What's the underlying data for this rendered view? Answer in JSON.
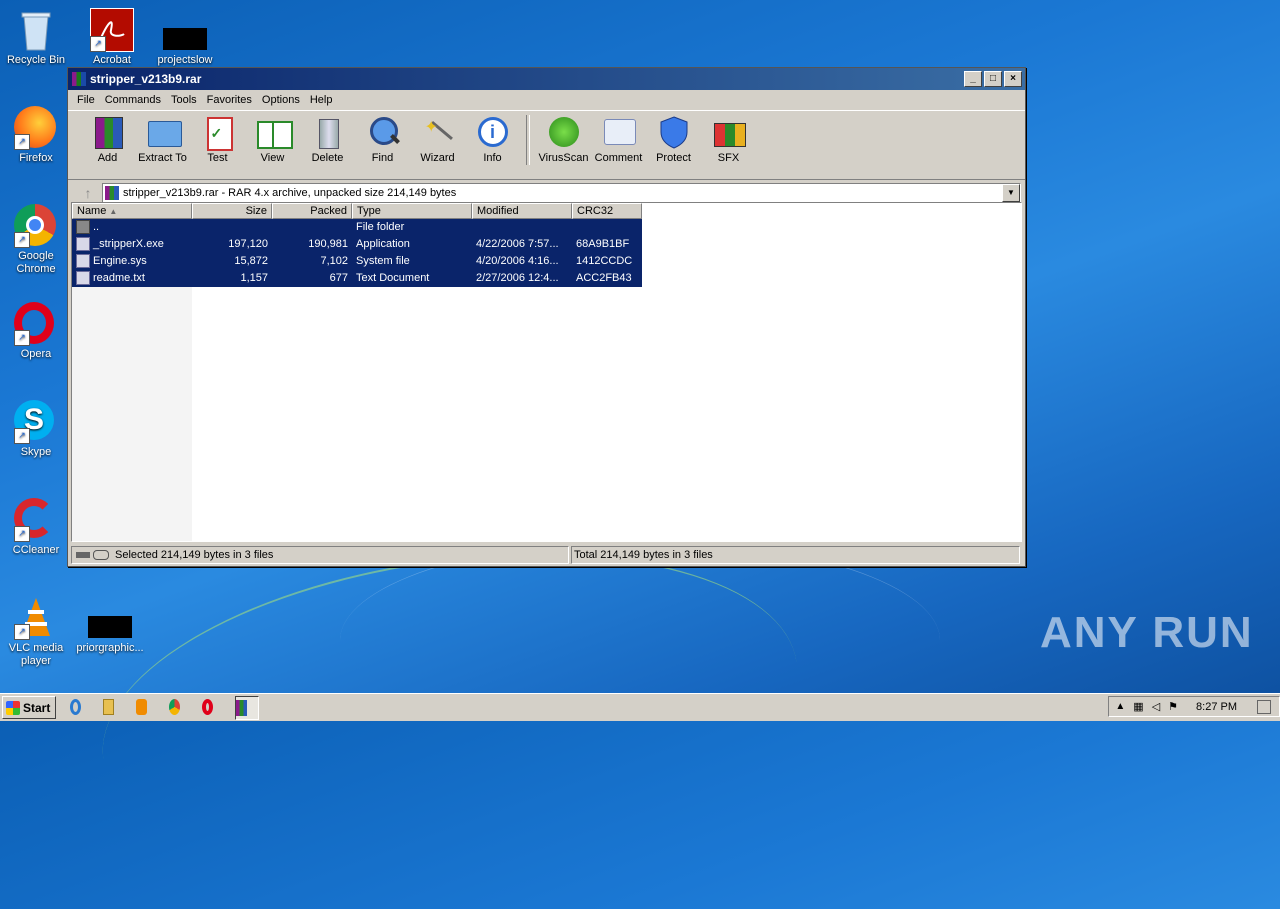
{
  "desktop": {
    "icons": [
      {
        "label": "Recycle Bin"
      },
      {
        "label": "Acrobat"
      },
      {
        "label": "projectslow"
      },
      {
        "label": "Firefox"
      },
      {
        "label": "Google Chrome"
      },
      {
        "label": "Opera"
      },
      {
        "label": "Skype"
      },
      {
        "label": "CCleaner"
      },
      {
        "label": "VLC media player"
      },
      {
        "label": "priorgraphic..."
      }
    ],
    "watermark": "ANY RUN"
  },
  "window": {
    "title": "stripper_v213b9.rar",
    "menu": [
      "File",
      "Commands",
      "Tools",
      "Favorites",
      "Options",
      "Help"
    ],
    "toolbar": [
      "Add",
      "Extract To",
      "Test",
      "View",
      "Delete",
      "Find",
      "Wizard",
      "Info",
      "VirusScan",
      "Comment",
      "Protect",
      "SFX"
    ],
    "path": "stripper_v213b9.rar - RAR 4.x archive, unpacked size 214,149 bytes",
    "columns": [
      "Name",
      "Size",
      "Packed",
      "Type",
      "Modified",
      "CRC32"
    ],
    "files": [
      {
        "name": "..",
        "size": "",
        "packed": "",
        "type": "File folder",
        "modified": "",
        "crc": ""
      },
      {
        "name": "_stripperX.exe",
        "size": "197,120",
        "packed": "190,981",
        "type": "Application",
        "modified": "4/22/2006 7:57...",
        "crc": "68A9B1BF"
      },
      {
        "name": "Engine.sys",
        "size": "15,872",
        "packed": "7,102",
        "type": "System file",
        "modified": "4/20/2006 4:16...",
        "crc": "1412CCDC"
      },
      {
        "name": "readme.txt",
        "size": "1,157",
        "packed": "677",
        "type": "Text Document",
        "modified": "2/27/2006 12:4...",
        "crc": "ACC2FB43"
      }
    ],
    "status_selected": "Selected 214,149 bytes in 3 files",
    "status_total": "Total 214,149 bytes in 3 files"
  },
  "taskbar": {
    "start": "Start",
    "clock": "8:27 PM"
  }
}
